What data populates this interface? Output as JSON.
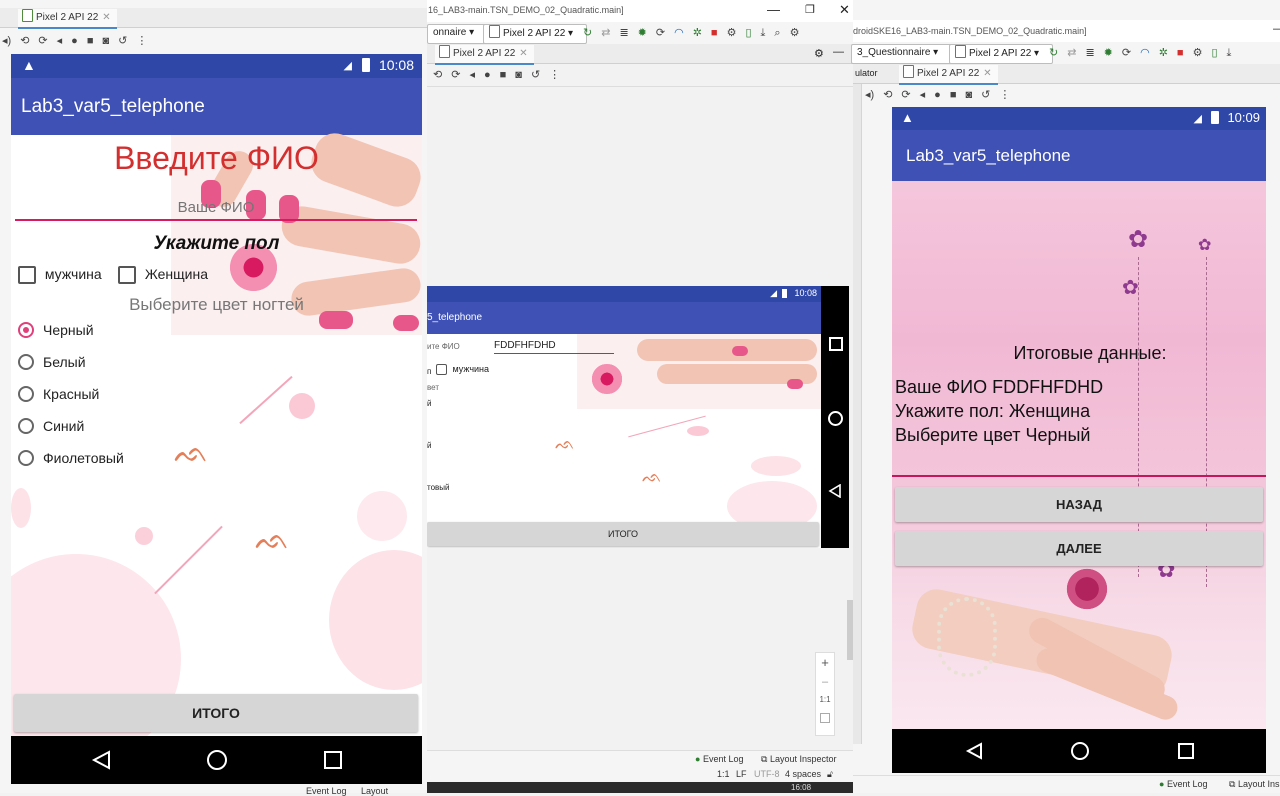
{
  "left": {
    "device_tab": "Pixel 2 API 22",
    "status_time": "10:08",
    "app_title": "Lab3_var5_telephone",
    "heading": "Введите ФИО",
    "name_placeholder": "Ваше ФИО",
    "gender_heading": "Укажите пол",
    "gender_options": [
      "мужчина",
      "Женщина"
    ],
    "color_heading": "Выберите цвет ногтей",
    "color_options": [
      "Черный",
      "Белый",
      "Красный",
      "Синий",
      "Фиолетовый"
    ],
    "total_button": "ИТОГО",
    "bottom_status": [
      "Event Log",
      "Layout"
    ]
  },
  "middle": {
    "window_title": "16_LAB3-main.TSN_DEMO_02_Quadratic.main]",
    "config_combo": "onnaire",
    "device_combo": "Pixel 2 API 22",
    "device_tab": "Pixel 2 API 22",
    "status_time": "10:08",
    "app_title": "5_telephone",
    "name_label": "ите ФИО",
    "name_value": "FDDFHFDHD",
    "gender_label": "п",
    "gender_option": "мужчина",
    "color_label": "вет",
    "fragments": [
      "й",
      "й",
      "товый"
    ],
    "total_button": "ИТОГО",
    "zoom_controls": [
      "+",
      "–",
      "1:1"
    ],
    "event_log": "Event Log",
    "layout_inspector": "Layout Inspector",
    "status_items": [
      "1:1",
      "LF",
      "UTF-8",
      "4 spaces"
    ],
    "clock": "16:08"
  },
  "right": {
    "window_title": "droidSKE16_LAB3-main.TSN_DEMO_02_Quadratic.main]",
    "config_combo": "3_Questionnaire",
    "device_combo": "Pixel 2 API 22",
    "emulator_label": "ulator",
    "device_tab": "Pixel 2 API 22",
    "status_time": "10:09",
    "app_title": "Lab3_var5_telephone",
    "result_heading": "Итоговые данные:",
    "result_lines": [
      "Ваше ФИО FDDFHFDHD",
      "Укажите пол: Женщина",
      "Выберите цвет Черный"
    ],
    "back_button": "НАЗАД",
    "next_button": "ДАЛЕЕ",
    "event_log": "Event Log",
    "layout_inspector": "Layout Ins"
  },
  "colors": {
    "appbar": "#3f51b5",
    "statusbar": "#2f48a8",
    "accent": "#e0407a",
    "heading_red": "#d32f2f"
  }
}
